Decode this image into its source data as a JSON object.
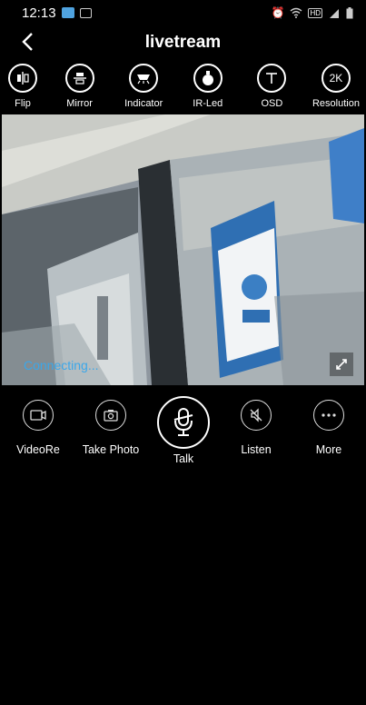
{
  "status_bar": {
    "time": "12:13"
  },
  "header": {
    "title": "livetream"
  },
  "toolbar": {
    "items": [
      {
        "label": "Flip",
        "icon": "flip-icon"
      },
      {
        "label": "Mirror",
        "icon": "mirror-icon"
      },
      {
        "label": "Indicator",
        "icon": "indicator-icon"
      },
      {
        "label": "IR-Led",
        "icon": "ir-led-icon"
      },
      {
        "label": "OSD",
        "icon": "osd-icon"
      },
      {
        "label": "Resolution",
        "icon": "resolution-icon",
        "badge": "2K"
      }
    ]
  },
  "video": {
    "status_text": "Connecting..."
  },
  "controls": {
    "items": [
      {
        "label": "VideoRe",
        "icon": "video-record-icon"
      },
      {
        "label": "Take Photo",
        "icon": "camera-icon"
      },
      {
        "label": "Talk",
        "icon": "microphone-icon"
      },
      {
        "label": "Listen",
        "icon": "speaker-muted-icon"
      },
      {
        "label": "More",
        "icon": "more-icon"
      }
    ]
  },
  "colors": {
    "background": "#000000",
    "accent": "#3aa7ea"
  }
}
